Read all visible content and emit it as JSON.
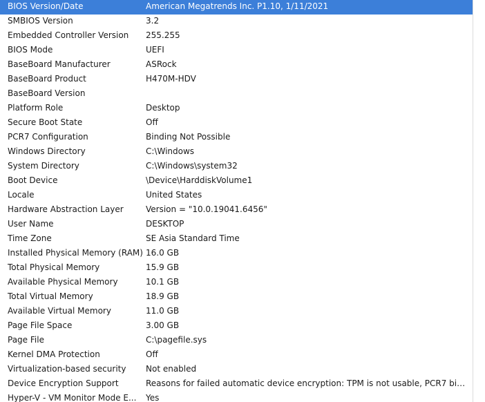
{
  "selected_index": 0,
  "rows": [
    {
      "item": "BIOS Version/Date",
      "value": "American Megatrends Inc. P1.10, 1/11/2021"
    },
    {
      "item": "SMBIOS Version",
      "value": "3.2"
    },
    {
      "item": "Embedded Controller Version",
      "value": "255.255"
    },
    {
      "item": "BIOS Mode",
      "value": "UEFI"
    },
    {
      "item": "BaseBoard Manufacturer",
      "value": "ASRock"
    },
    {
      "item": "BaseBoard Product",
      "value": "H470M-HDV"
    },
    {
      "item": "BaseBoard Version",
      "value": ""
    },
    {
      "item": "Platform Role",
      "value": "Desktop"
    },
    {
      "item": "Secure Boot State",
      "value": "Off"
    },
    {
      "item": "PCR7 Configuration",
      "value": "Binding Not Possible"
    },
    {
      "item": "Windows Directory",
      "value": "C:\\Windows"
    },
    {
      "item": "System Directory",
      "value": "C:\\Windows\\system32"
    },
    {
      "item": "Boot Device",
      "value": "\\Device\\HarddiskVolume1"
    },
    {
      "item": "Locale",
      "value": "United States"
    },
    {
      "item": "Hardware Abstraction Layer",
      "value": "Version = \"10.0.19041.6456\""
    },
    {
      "item": "User Name",
      "value": "DESKTOP"
    },
    {
      "item": "Time Zone",
      "value": "SE Asia Standard Time"
    },
    {
      "item": "Installed Physical Memory (RAM)",
      "value": "16.0 GB"
    },
    {
      "item": "Total Physical Memory",
      "value": "15.9 GB"
    },
    {
      "item": "Available Physical Memory",
      "value": "10.1 GB"
    },
    {
      "item": "Total Virtual Memory",
      "value": "18.9 GB"
    },
    {
      "item": "Available Virtual Memory",
      "value": "11.0 GB"
    },
    {
      "item": "Page File Space",
      "value": "3.00 GB"
    },
    {
      "item": "Page File",
      "value": "C:\\pagefile.sys"
    },
    {
      "item": "Kernel DMA Protection",
      "value": "Off"
    },
    {
      "item": "Virtualization-based security",
      "value": "Not enabled"
    },
    {
      "item": "Device Encryption Support",
      "value": "Reasons for failed automatic device encryption: TPM is not usable, PCR7 bindi..."
    },
    {
      "item": "Hyper-V - VM Monitor Mode E...",
      "value": "Yes"
    }
  ]
}
